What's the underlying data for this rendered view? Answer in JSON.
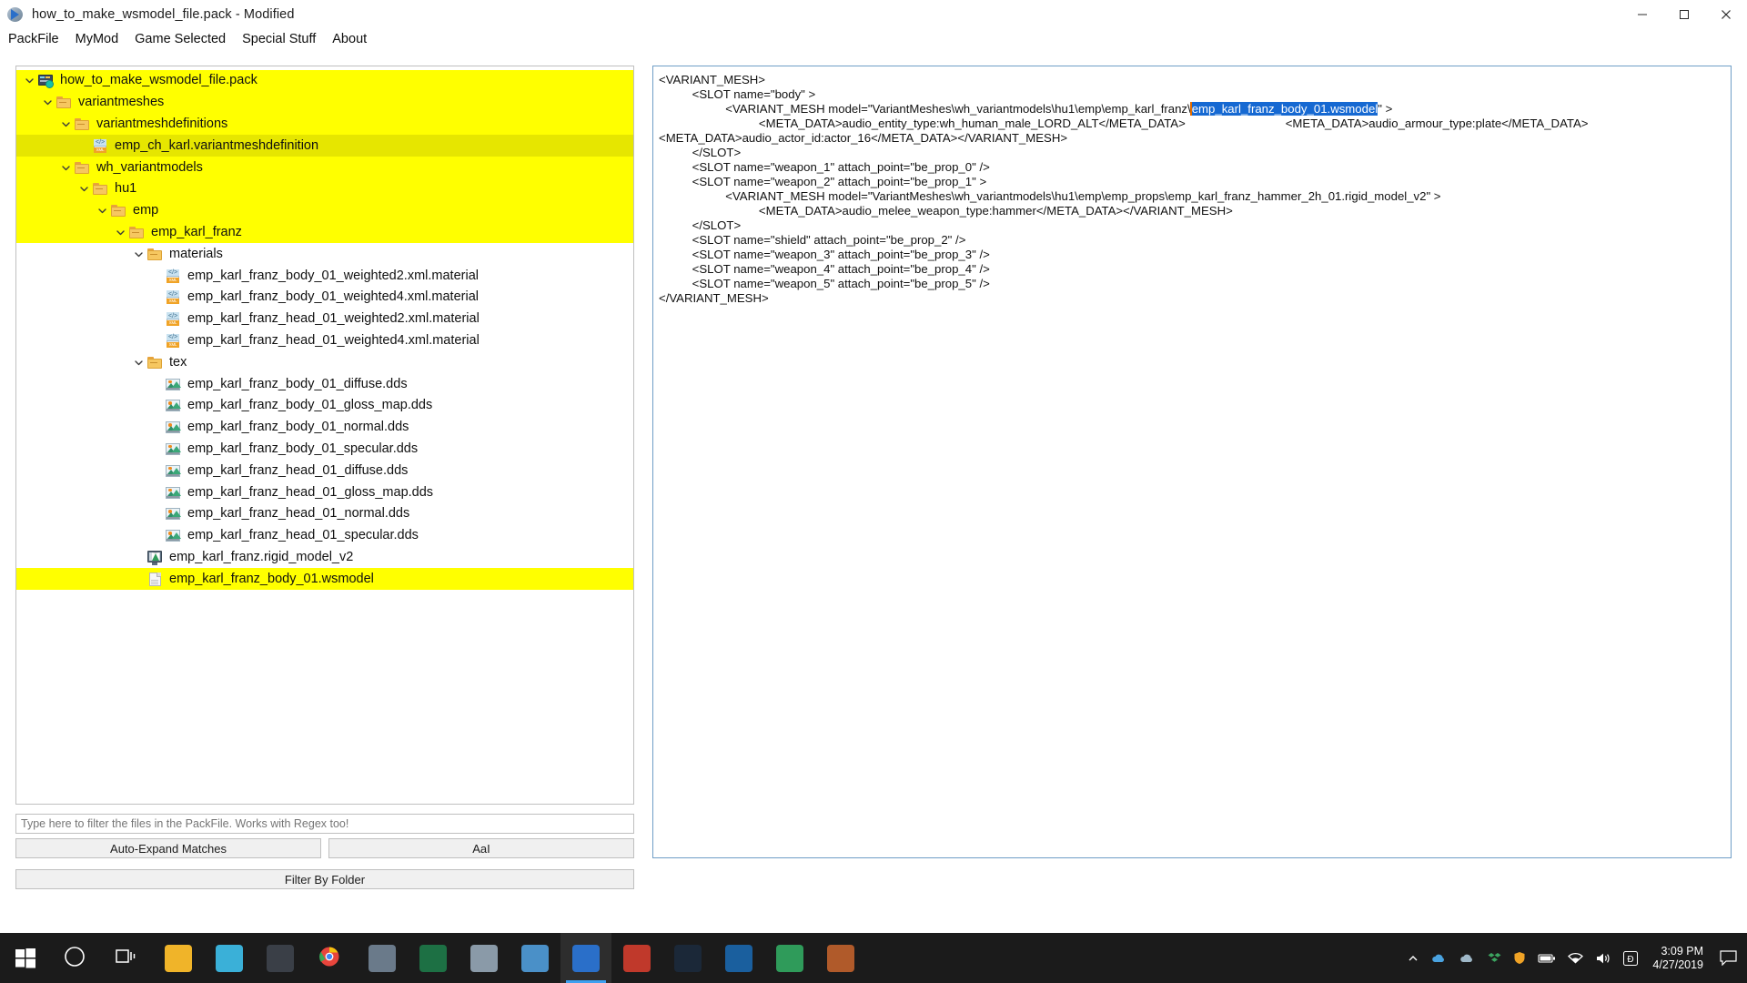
{
  "window": {
    "title": "how_to_make_wsmodel_file.pack - Modified",
    "app_icon": "rpfm-disc-icon",
    "controls": {
      "minimize": "minimize-icon",
      "maximize": "maximize-icon",
      "close": "close-icon"
    }
  },
  "menubar": {
    "items": [
      {
        "label": "PackFile"
      },
      {
        "label": "MyMod"
      },
      {
        "label": "Game Selected"
      },
      {
        "label": "Special Stuff"
      },
      {
        "label": "About"
      }
    ]
  },
  "tree": {
    "nodes": [
      {
        "label": "how_to_make_wsmodel_file.pack",
        "depth": 0,
        "icon": "pack-icon",
        "expanded": true,
        "highlight": "yellow"
      },
      {
        "label": "variantmeshes",
        "depth": 1,
        "icon": "folder-icon",
        "expanded": true,
        "highlight": "yellow"
      },
      {
        "label": "variantmeshdefinitions",
        "depth": 2,
        "icon": "folder-icon",
        "expanded": true,
        "highlight": "yellow"
      },
      {
        "label": "emp_ch_karl.variantmeshdefinition",
        "depth": 3,
        "icon": "xml-icon",
        "expanded": null,
        "highlight": "olive"
      },
      {
        "label": "wh_variantmodels",
        "depth": 2,
        "icon": "folder-icon",
        "expanded": true,
        "highlight": "yellow"
      },
      {
        "label": "hu1",
        "depth": 3,
        "icon": "folder-icon",
        "expanded": true,
        "highlight": "yellow"
      },
      {
        "label": "emp",
        "depth": 4,
        "icon": "folder-icon",
        "expanded": true,
        "highlight": "yellow"
      },
      {
        "label": "emp_karl_franz",
        "depth": 5,
        "icon": "folder-icon",
        "expanded": true,
        "highlight": "yellow"
      },
      {
        "label": "materials",
        "depth": 6,
        "icon": "folder-icon",
        "expanded": true,
        "highlight": "none"
      },
      {
        "label": "emp_karl_franz_body_01_weighted2.xml.material",
        "depth": 7,
        "icon": "xml-icon",
        "expanded": null,
        "highlight": "none"
      },
      {
        "label": "emp_karl_franz_body_01_weighted4.xml.material",
        "depth": 7,
        "icon": "xml-icon",
        "expanded": null,
        "highlight": "none"
      },
      {
        "label": "emp_karl_franz_head_01_weighted2.xml.material",
        "depth": 7,
        "icon": "xml-icon",
        "expanded": null,
        "highlight": "none"
      },
      {
        "label": "emp_karl_franz_head_01_weighted4.xml.material",
        "depth": 7,
        "icon": "xml-icon",
        "expanded": null,
        "highlight": "none"
      },
      {
        "label": "tex",
        "depth": 6,
        "icon": "folder-icon",
        "expanded": true,
        "highlight": "none"
      },
      {
        "label": "emp_karl_franz_body_01_diffuse.dds",
        "depth": 7,
        "icon": "image-icon",
        "expanded": null,
        "highlight": "none"
      },
      {
        "label": "emp_karl_franz_body_01_gloss_map.dds",
        "depth": 7,
        "icon": "image-icon",
        "expanded": null,
        "highlight": "none"
      },
      {
        "label": "emp_karl_franz_body_01_normal.dds",
        "depth": 7,
        "icon": "image-icon",
        "expanded": null,
        "highlight": "none"
      },
      {
        "label": "emp_karl_franz_body_01_specular.dds",
        "depth": 7,
        "icon": "image-icon",
        "expanded": null,
        "highlight": "none"
      },
      {
        "label": "emp_karl_franz_head_01_diffuse.dds",
        "depth": 7,
        "icon": "image-icon",
        "expanded": null,
        "highlight": "none"
      },
      {
        "label": "emp_karl_franz_head_01_gloss_map.dds",
        "depth": 7,
        "icon": "image-icon",
        "expanded": null,
        "highlight": "none"
      },
      {
        "label": "emp_karl_franz_head_01_normal.dds",
        "depth": 7,
        "icon": "image-icon",
        "expanded": null,
        "highlight": "none"
      },
      {
        "label": "emp_karl_franz_head_01_specular.dds",
        "depth": 7,
        "icon": "image-icon",
        "expanded": null,
        "highlight": "none"
      },
      {
        "label": "emp_karl_franz.rigid_model_v2",
        "depth": 6,
        "icon": "model-icon",
        "expanded": null,
        "highlight": "none"
      },
      {
        "label": "emp_karl_franz_body_01.wsmodel",
        "depth": 6,
        "icon": "file-icon",
        "expanded": null,
        "highlight": "yellow"
      }
    ]
  },
  "filter": {
    "placeholder": "Type here to filter the files in the PackFile. Works with Regex too!",
    "value": "",
    "auto_expand_label": "Auto-Expand Matches",
    "case_label": "AaI",
    "folder_label": "Filter By Folder"
  },
  "editor": {
    "segments": [
      {
        "text": "<VARIANT_MESH>\n          <SLOT name=\"body\" >\n                    <VARIANT_MESH model=\"VariantMeshes\\wh_variantmodels\\hu1\\emp\\emp_karl_franz\\",
        "style": "plain"
      },
      {
        "text": "emp_karl_franz_body_01.wsmodel",
        "style": "selected"
      },
      {
        "text": "\" >\n                              <META_DATA>audio_entity_type:wh_human_male_LORD_ALT</META_DATA>                              <META_DATA>audio_armour_type:plate</META_DATA>                              <META_DATA>audio_actor_id:actor_16</META_DATA></VARIANT_MESH>\n          </SLOT>\n          <SLOT name=\"weapon_1\" attach_point=\"be_prop_0\" />\n          <SLOT name=\"weapon_2\" attach_point=\"be_prop_1\" >\n                    <VARIANT_MESH model=\"VariantMeshes\\wh_variantmodels\\hu1\\emp\\emp_props\\emp_karl_franz_hammer_2h_01.rigid_model_v2\" >\n                              <META_DATA>audio_melee_weapon_type:hammer</META_DATA></VARIANT_MESH>\n          </SLOT>\n          <SLOT name=\"shield\" attach_point=\"be_prop_2\" />\n          <SLOT name=\"weapon_3\" attach_point=\"be_prop_3\" />\n          <SLOT name=\"weapon_4\" attach_point=\"be_prop_4\" />\n          <SLOT name=\"weapon_5\" attach_point=\"be_prop_5\" />\n</VARIANT_MESH>",
        "style": "plain"
      }
    ]
  },
  "taskbar": {
    "start": "windows-start-icon",
    "items": [
      {
        "icon": "cortana-search-icon",
        "active": false
      },
      {
        "icon": "task-view-icon",
        "active": false
      },
      {
        "icon": "file-explorer-icon",
        "active": false
      },
      {
        "icon": "photo-viewer-icon",
        "active": false
      },
      {
        "icon": "user-account-icon",
        "active": false
      },
      {
        "icon": "google-chrome-icon",
        "active": false
      },
      {
        "icon": "remote-desktop-icon",
        "active": false
      },
      {
        "icon": "excel-icon",
        "active": false
      },
      {
        "icon": "printer-icon",
        "active": false
      },
      {
        "icon": "notepad-icon",
        "active": false
      },
      {
        "icon": "rpfm-app-icon",
        "active": true
      },
      {
        "icon": "media-player-icon",
        "active": false
      },
      {
        "icon": "steam-icon",
        "active": false
      },
      {
        "icon": "uplay-icon",
        "active": false
      },
      {
        "icon": "gimp-icon",
        "active": false
      },
      {
        "icon": "rocket-app-icon",
        "active": false
      }
    ],
    "tray": [
      {
        "icon": "show-hidden-icons-chevron"
      },
      {
        "icon": "onedrive-cloud-icon"
      },
      {
        "icon": "cloud-sync-icon"
      },
      {
        "icon": "dropbox-icon"
      },
      {
        "icon": "security-shield-icon"
      },
      {
        "icon": "battery-icon"
      },
      {
        "icon": "wifi-icon"
      },
      {
        "icon": "volume-icon"
      },
      {
        "icon": "language-indicator"
      }
    ],
    "language": "Ð",
    "clock": {
      "time": "3:09 PM",
      "date": "4/27/2019"
    },
    "action_center": "action-center-icon"
  },
  "colors": {
    "highlight_yellow": "#ffff00",
    "highlight_olive": "#e6e600",
    "selection_blue": "#1669d2",
    "caret_orange": "#e06c00",
    "editor_border": "#6f9ec6",
    "taskbar": "#1b1b1b"
  }
}
